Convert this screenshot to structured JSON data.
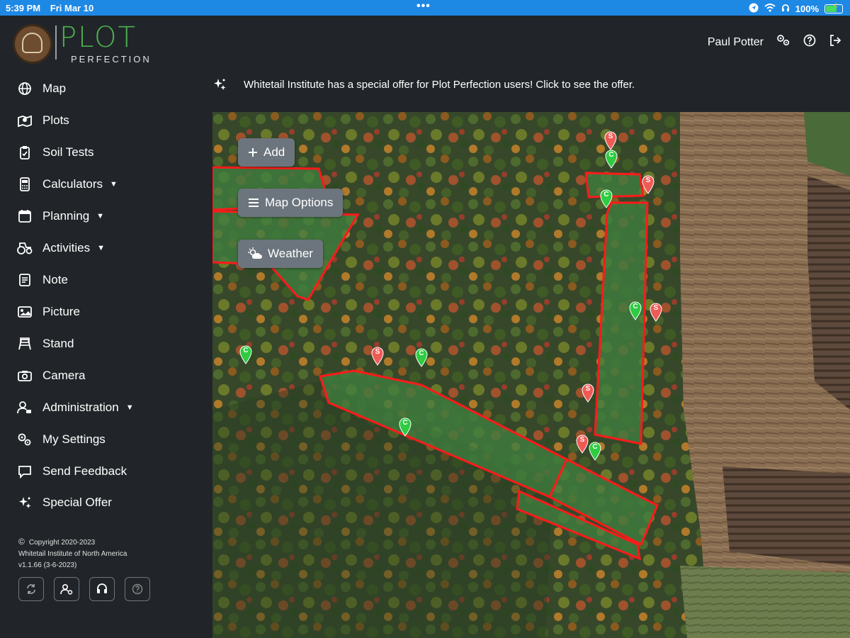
{
  "status_bar": {
    "time": "5:39 PM",
    "date": "Fri Mar 10",
    "battery": "100%"
  },
  "app": {
    "logo_word": "PLOT",
    "logo_sub": "PERFECTION"
  },
  "header": {
    "user_name": "Paul Potter"
  },
  "offer_banner": {
    "text": "Whitetail Institute has a special offer for Plot Perfection users! Click to see the offer."
  },
  "nav": [
    {
      "label": "Map",
      "icon": "globe-icon"
    },
    {
      "label": "Plots",
      "icon": "plots-icon"
    },
    {
      "label": "Soil Tests",
      "icon": "soil-test-icon"
    },
    {
      "label": "Calculators",
      "icon": "calculator-icon",
      "caret": true
    },
    {
      "label": "Planning",
      "icon": "calendar-icon",
      "caret": true
    },
    {
      "label": "Activities",
      "icon": "tractor-icon",
      "caret": true
    },
    {
      "label": "Note",
      "icon": "note-icon"
    },
    {
      "label": "Picture",
      "icon": "picture-icon"
    },
    {
      "label": "Stand",
      "icon": "stand-icon"
    },
    {
      "label": "Camera",
      "icon": "camera-icon"
    },
    {
      "label": "Administration",
      "icon": "admin-icon",
      "caret": true
    },
    {
      "label": "My Settings",
      "icon": "settings-icon"
    },
    {
      "label": "Send Feedback",
      "icon": "feedback-icon"
    },
    {
      "label": "Special Offer",
      "icon": "sparkle-icon"
    }
  ],
  "footer": {
    "copyright": "Copyright 2020-2023",
    "company": "Whitetail Institute of North America",
    "version": "v1.1.66 (3-6-2023)"
  },
  "map_buttons": {
    "add": "Add",
    "map_options": "Map Options",
    "weather": "Weather"
  },
  "pins": {
    "camera_label": "C",
    "stand_label": "S",
    "camera_color": "#2ecc40",
    "stand_color": "#f05a55"
  },
  "colors": {
    "statusbar": "#1e88e5",
    "accent_green": "#4caf50",
    "plot_outline": "#ff1a1a",
    "sidebar_bg": "#212529"
  }
}
